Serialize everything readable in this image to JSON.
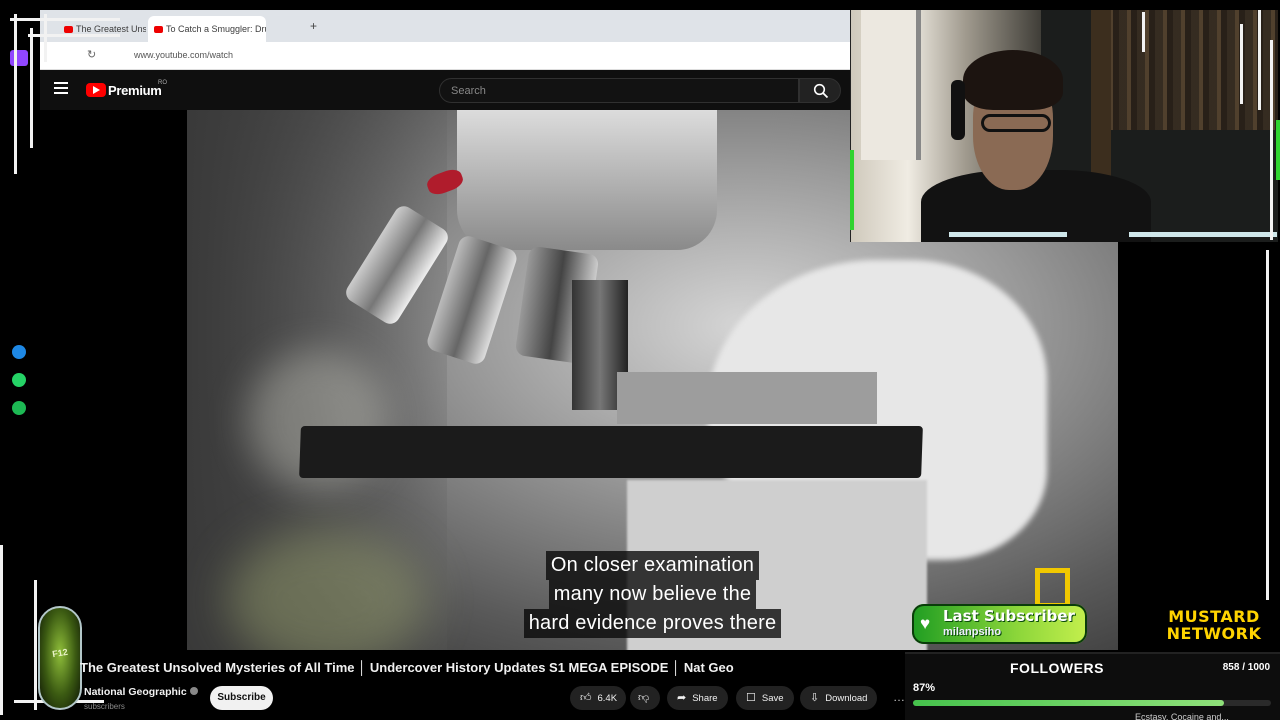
{
  "browser": {
    "tabs": [
      {
        "label": "The Greatest Unsolved"
      },
      {
        "label": "To Catch a Smuggler: Drug"
      }
    ],
    "new_tab_icon": "+",
    "url": "www.youtube.com/watch"
  },
  "youtube_header": {
    "brand": "Premium",
    "region": "RO",
    "search_placeholder": "Search"
  },
  "video": {
    "subtitle_lines": [
      "On closer examination",
      "many now believe the",
      "hard evidence proves there"
    ],
    "title": "The Greatest Unsolved Mysteries of All Time │ Undercover History Updates S1 MEGA EPISODE │ Nat Geo",
    "channel": "National Geographic",
    "subscribers": "subscribers",
    "subscribe_label": "Subscribe",
    "actions": {
      "likes": "6.4K",
      "share": "Share",
      "save": "Save",
      "download": "Download",
      "more": "…"
    }
  },
  "overlay": {
    "last_subscriber_label": "Last Subscriber",
    "last_subscriber_name": "milanpsiho",
    "followers_title": "FOLLOWERS",
    "followers_count": "858 / 1000",
    "followers_percent": "87%",
    "followers_progress": 0.87,
    "network_name_lines": [
      "MUSTARD",
      "NETWORK"
    ],
    "below_peek": "Ecstasy, Cocaine and..."
  },
  "colors": {
    "accent_green": "#46c24c",
    "youtube_red": "#ff0000",
    "twitch_purple": "#9146ff",
    "mustard_yellow": "#ffd400"
  }
}
